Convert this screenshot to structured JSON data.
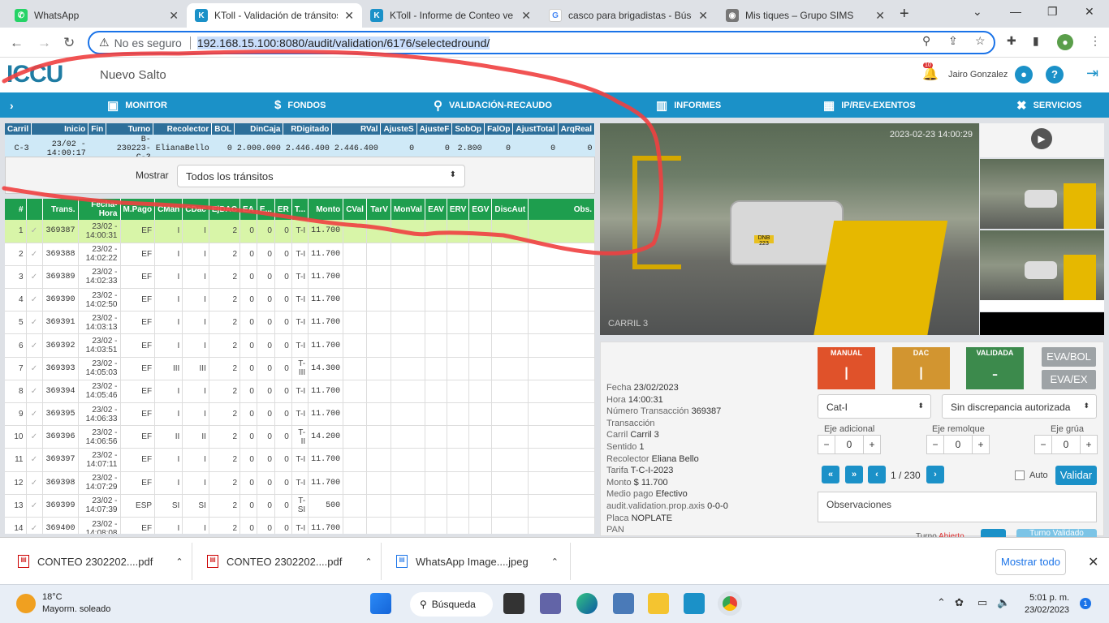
{
  "tabs": [
    {
      "title": "WhatsApp",
      "icon": "whatsapp-icon",
      "color": "#25d366"
    },
    {
      "title": "KToll - Validación de tránsitos",
      "icon": "ktoll-icon",
      "color": "#1b91c8"
    },
    {
      "title": "KToll - Informe de Conteo ve",
      "icon": "ktoll-icon",
      "color": "#1b91c8"
    },
    {
      "title": "casco para brigadistas - Búsq",
      "icon": "google-icon",
      "color": "#4285f4"
    },
    {
      "title": "Mis tiques – Grupo SIMS",
      "icon": "globe-icon",
      "color": "#777777"
    }
  ],
  "address": {
    "security": "No es seguro",
    "url": "192.168.15.100:8080/audit/validation/6176/selectedround/"
  },
  "app": {
    "logo": "ICCU",
    "site": "Nuevo Salto",
    "user": "Jairo Gonzalez",
    "notif_count": "10"
  },
  "menu": [
    "MONITOR",
    "FONDOS",
    "VALIDACIÓN-RECAUDO",
    "INFORMES",
    "IP/REV-EXENTOS",
    "SERVICIOS"
  ],
  "summary": {
    "headers": [
      "Carril",
      "Inicio",
      "Fin",
      "Turno",
      "Recolector",
      "BOL",
      "DinCaja",
      "RDigitado",
      "RVal",
      "AjusteS",
      "AjusteF",
      "SobOp",
      "FalOp",
      "AjustTotal",
      "ArqReal"
    ],
    "row": [
      "C-3",
      "23/02 - 14:00:17",
      "",
      "B-230223-C-3",
      "ElianaBello",
      "0",
      "2.000.000",
      "2.446.400",
      "2.446.400",
      "0",
      "0",
      "2.800",
      "0",
      "0",
      "0"
    ]
  },
  "filter": {
    "label": "Mostrar",
    "value": "Todos los tránsitos"
  },
  "grid": {
    "headers": [
      "#",
      "",
      "Trans.",
      "Fecha-Hora",
      "M.Pago",
      "CMan",
      "CDac",
      "EjDAC",
      "EA",
      "E...",
      "ER",
      "T...",
      "Monto",
      "CVal",
      "TarV",
      "MonVal",
      "EAV",
      "ERV",
      "EGV",
      "DiscAut",
      "Obs."
    ],
    "rows": [
      [
        "1",
        "✓",
        "369387",
        "23/02 - 14:00:31",
        "EF",
        "I",
        "I",
        "2",
        "0",
        "0",
        "0",
        "T-I",
        "11.700"
      ],
      [
        "2",
        "✓",
        "369388",
        "23/02 - 14:02:22",
        "EF",
        "I",
        "I",
        "2",
        "0",
        "0",
        "0",
        "T-I",
        "11.700"
      ],
      [
        "3",
        "✓",
        "369389",
        "23/02 - 14:02:33",
        "EF",
        "I",
        "I",
        "2",
        "0",
        "0",
        "0",
        "T-I",
        "11.700"
      ],
      [
        "4",
        "✓",
        "369390",
        "23/02 - 14:02:50",
        "EF",
        "I",
        "I",
        "2",
        "0",
        "0",
        "0",
        "T-I",
        "11.700"
      ],
      [
        "5",
        "✓",
        "369391",
        "23/02 - 14:03:13",
        "EF",
        "I",
        "I",
        "2",
        "0",
        "0",
        "0",
        "T-I",
        "11.700"
      ],
      [
        "6",
        "✓",
        "369392",
        "23/02 - 14:03:51",
        "EF",
        "I",
        "I",
        "2",
        "0",
        "0",
        "0",
        "T-I",
        "11.700"
      ],
      [
        "7",
        "✓",
        "369393",
        "23/02 - 14:05:03",
        "EF",
        "III",
        "III",
        "2",
        "0",
        "0",
        "0",
        "T-III",
        "14.300"
      ],
      [
        "8",
        "✓",
        "369394",
        "23/02 - 14:05:46",
        "EF",
        "I",
        "I",
        "2",
        "0",
        "0",
        "0",
        "T-I",
        "11.700"
      ],
      [
        "9",
        "✓",
        "369395",
        "23/02 - 14:06:33",
        "EF",
        "I",
        "I",
        "2",
        "0",
        "0",
        "0",
        "T-I",
        "11.700"
      ],
      [
        "10",
        "✓",
        "369396",
        "23/02 - 14:06:56",
        "EF",
        "II",
        "II",
        "2",
        "0",
        "0",
        "0",
        "T-II",
        "14.200"
      ],
      [
        "11",
        "✓",
        "369397",
        "23/02 - 14:07:11",
        "EF",
        "I",
        "I",
        "2",
        "0",
        "0",
        "0",
        "T-I",
        "11.700"
      ],
      [
        "12",
        "✓",
        "369398",
        "23/02 - 14:07:29",
        "EF",
        "I",
        "I",
        "2",
        "0",
        "0",
        "0",
        "T-I",
        "11.700"
      ],
      [
        "13",
        "✓",
        "369399",
        "23/02 - 14:07:39",
        "ESP",
        "SI",
        "SI",
        "2",
        "0",
        "0",
        "0",
        "T-SI",
        "500"
      ],
      [
        "14",
        "✓",
        "369400",
        "23/02 - 14:08:08",
        "EF",
        "I",
        "I",
        "2",
        "0",
        "0",
        "0",
        "T-I",
        "11.700"
      ]
    ]
  },
  "camera": {
    "timestamp": "2023-02-23 14:00:29",
    "lane": "CARRIL 3",
    "plate": "DNB 223"
  },
  "detail": [
    [
      "Fecha",
      "23/02/2023"
    ],
    [
      "Hora",
      "14:00:31"
    ],
    [
      "Número Transacción",
      "369387"
    ],
    [
      "Transacción",
      ""
    ],
    [
      "Carril",
      "Carril 3"
    ],
    [
      "Sentido",
      "1"
    ],
    [
      "Recolector",
      "Eliana Bello"
    ],
    [
      "Tarifa",
      "T-C-I-2023"
    ],
    [
      "Monto",
      "$ 11.700"
    ],
    [
      "Medio pago",
      "Efectivo"
    ],
    [
      "audit.validation.prop.axis",
      "0-0-0"
    ],
    [
      "Placa",
      "NOPLATE"
    ],
    [
      "PAN",
      ""
    ]
  ],
  "badges": [
    {
      "label": "MANUAL",
      "value": "I",
      "color": "#e0522a"
    },
    {
      "label": "DAC",
      "value": "I",
      "color": "#d29530"
    },
    {
      "label": "VALIDADA",
      "value": "-",
      "color": "#3c8a4c"
    }
  ],
  "buttons": {
    "evabol": "EVA/BOL",
    "evaex": "EVA/EX",
    "validar": "Validar",
    "turno_validado": "Turno Validado"
  },
  "selects": {
    "cat": "Cat-I",
    "disc": "Sin discrepancia autorizada"
  },
  "ejes": [
    {
      "label": "Eje adicional",
      "value": "0"
    },
    {
      "label": "Eje remolque",
      "value": "0"
    },
    {
      "label": "Eje grúa",
      "value": "0"
    }
  ],
  "pager": {
    "text": "1 / 230",
    "auto": "Auto"
  },
  "observaciones": "Observaciones",
  "turno": {
    "label": "Turno",
    "state": "Abierto"
  },
  "downloads": [
    {
      "name": "CONTEO 2302202....pdf",
      "type": "pdf"
    },
    {
      "name": "CONTEO 2302202....pdf",
      "type": "pdf"
    },
    {
      "name": "WhatsApp Image....jpeg",
      "type": "img"
    }
  ],
  "showall": "Mostrar todo",
  "taskbar": {
    "temp": "18°C",
    "weather": "Mayorm. soleado",
    "search": "Búsqueda",
    "time": "5:01 p. m.",
    "date": "23/02/2023",
    "notif": "1"
  }
}
